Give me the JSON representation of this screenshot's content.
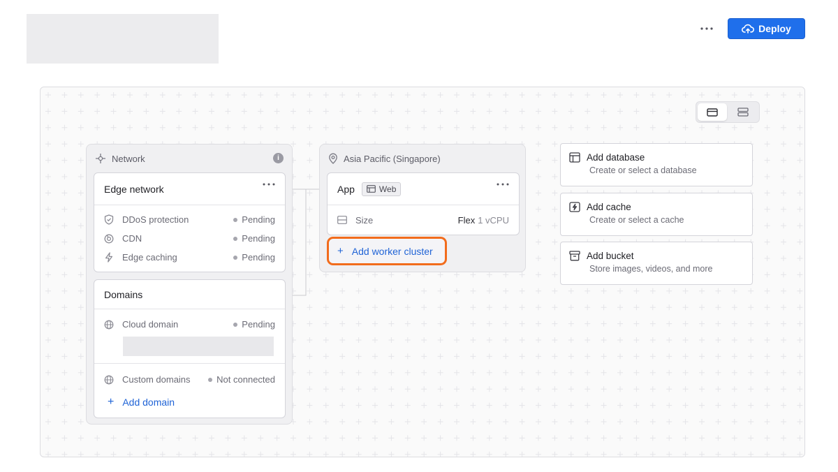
{
  "header": {
    "deploy_label": "Deploy"
  },
  "canvas": {
    "network": {
      "title": "Network",
      "info_glyph": "i",
      "edge_network": {
        "title": "Edge network",
        "items": [
          {
            "label": "DDoS protection",
            "status": "Pending",
            "icon": "shield-icon"
          },
          {
            "label": "CDN",
            "status": "Pending",
            "icon": "cdn-icon"
          },
          {
            "label": "Edge caching",
            "status": "Pending",
            "icon": "lightning-icon"
          }
        ]
      },
      "domains": {
        "title": "Domains",
        "cloud_domain": {
          "label": "Cloud domain",
          "status": "Pending"
        },
        "custom_domains": {
          "label": "Custom domains",
          "status": "Not connected"
        },
        "add_domain_label": "Add domain"
      }
    },
    "region": {
      "title": "Asia Pacific (Singapore)",
      "app": {
        "title": "App",
        "badge": "Web",
        "size_label": "Size",
        "size_value_main": "Flex",
        "size_value_sub": "1 vCPU"
      },
      "add_worker_label": "Add worker cluster"
    },
    "resources": [
      {
        "title": "Add database",
        "subtitle": "Create or select a database",
        "icon": "database-icon"
      },
      {
        "title": "Add cache",
        "subtitle": "Create or select a cache",
        "icon": "cache-icon"
      },
      {
        "title": "Add bucket",
        "subtitle": "Store images, videos, and more",
        "icon": "bucket-icon"
      }
    ]
  },
  "colors": {
    "accent": "#1f6feb",
    "link": "#1f63d6",
    "highlight": "#f26c1c"
  }
}
